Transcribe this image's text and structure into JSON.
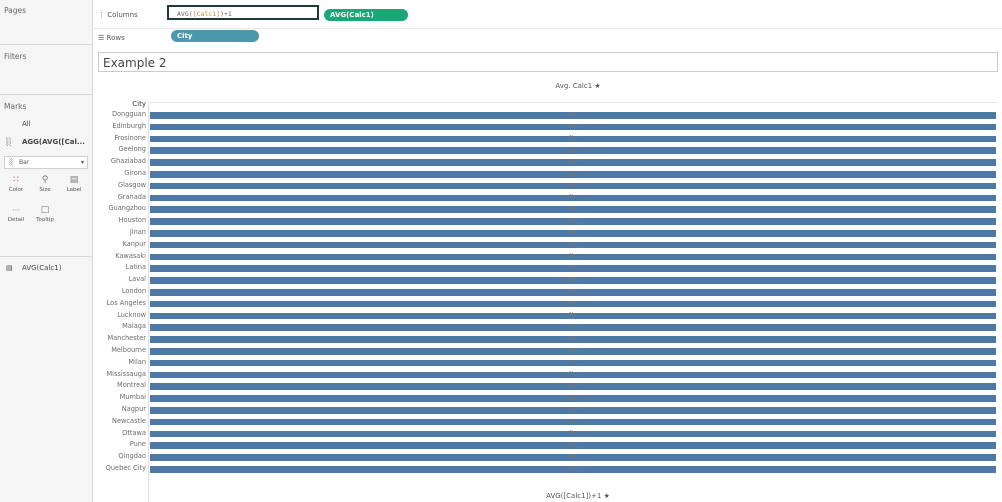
{
  "sidebar": {
    "pages_label": "Pages",
    "filters_label": "Filters",
    "marks_label": "Marks",
    "all_label": "All",
    "agg_label": "AGG(AVG([Cal...",
    "mark_type": "Bar",
    "tiles": [
      {
        "label": "Color",
        "icon": "color-icon"
      },
      {
        "label": "Size",
        "icon": "size-icon"
      },
      {
        "label": "Label",
        "icon": "label-icon"
      },
      {
        "label": "Detail",
        "icon": "detail-icon"
      },
      {
        "label": "Tooltip",
        "icon": "tooltip-icon"
      }
    ],
    "measure_label": "AVG(Calc1)"
  },
  "shelves": {
    "columns_label": "Columns",
    "columns_calc_prefix": "AVG(",
    "columns_calc_field": "[Calc1]",
    "columns_calc_suffix": ")+1",
    "columns_pill": "AVG(Calc1)",
    "rows_label": "Rows",
    "rows_pill": "City"
  },
  "colors": {
    "columns_pill": "#1aa775",
    "rows_pill": "#4b98ac",
    "bar": "#4e79a7"
  },
  "sheet_title": "Example 2",
  "chart_data": {
    "type": "bar",
    "orientation": "horizontal",
    "top_axis_title": "Avg. Calc1",
    "bottom_axis_title": "AVG([Calc1])+1",
    "row_header": "City",
    "bar_label_text": "Abc",
    "categories": [
      "Dongguan",
      "Edinburgh",
      "Frosinone",
      "Geelong",
      "Ghaziabad",
      "Girona",
      "Glasgow",
      "Granada",
      "Guangzhou",
      "Houston",
      "Jinan",
      "Kanpur",
      "Kawasaki",
      "Latina",
      "Laval",
      "London",
      "Los Angeles",
      "Lucknow",
      "Malaga",
      "Manchester",
      "Melbourne",
      "Milan",
      "Mississauga",
      "Montreal",
      "Mumbai",
      "Nagpur",
      "Newcastle",
      "Ottawa",
      "Pune",
      "Qingdao",
      "Quebec City"
    ],
    "values": [
      1,
      1,
      1,
      1,
      1,
      1,
      1,
      1,
      1,
      1,
      1,
      1,
      1,
      1,
      1,
      1,
      1,
      1,
      1,
      1,
      1,
      1,
      1,
      1,
      1,
      1,
      1,
      1,
      1,
      1,
      1
    ],
    "xlim": [
      0,
      1
    ]
  }
}
